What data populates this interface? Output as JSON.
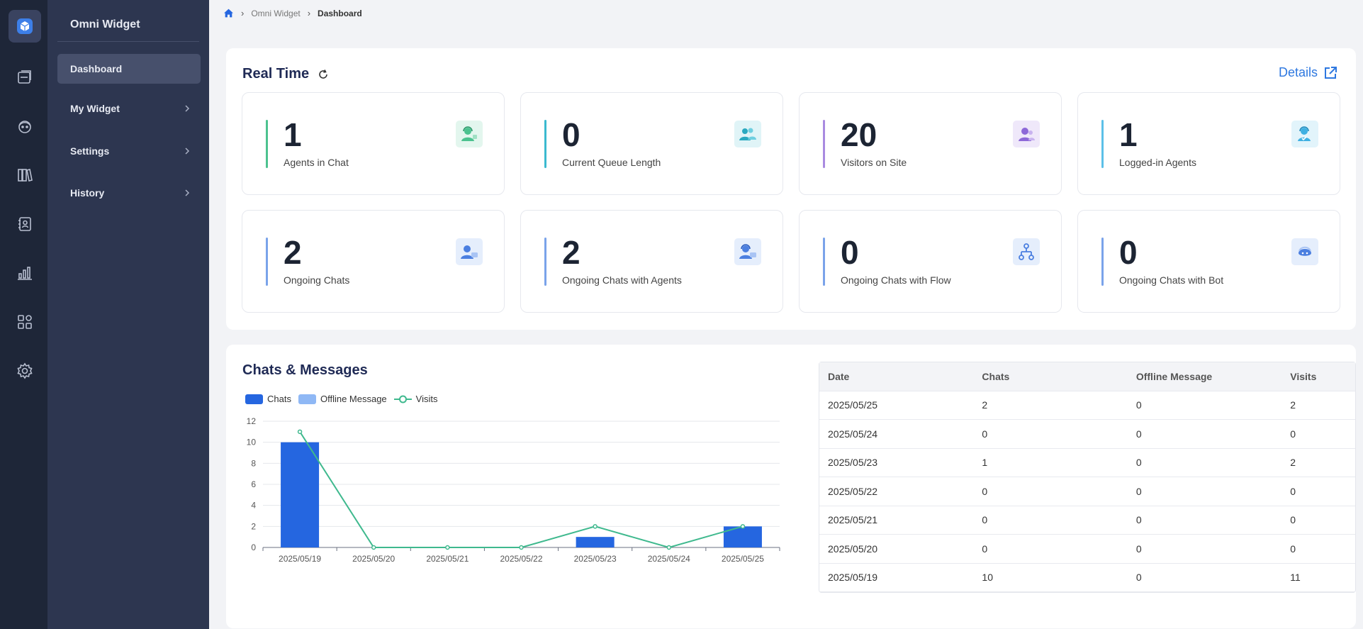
{
  "sidebar": {
    "title": "Omni Widget",
    "items": [
      {
        "label": "Dashboard"
      },
      {
        "label": "My Widget"
      },
      {
        "label": "Settings"
      },
      {
        "label": "History"
      }
    ]
  },
  "breadcrumb": {
    "items": [
      "Omni Widget",
      "Dashboard"
    ]
  },
  "realtime": {
    "title": "Real Time",
    "details_label": "Details",
    "cards": [
      {
        "value": "1",
        "label": "Agents in Chat",
        "accent": "#4cc28f",
        "icon": "agent-headset-icon"
      },
      {
        "value": "0",
        "label": "Current Queue Length",
        "accent": "#3bbad0",
        "icon": "queue-users-icon"
      },
      {
        "value": "20",
        "label": "Visitors on Site",
        "accent": "#a98ae0",
        "icon": "visitors-icon"
      },
      {
        "value": "1",
        "label": "Logged-in Agents",
        "accent": "#5cc0e8",
        "icon": "logged-agent-icon"
      },
      {
        "value": "2",
        "label": "Ongoing Chats",
        "accent": "#7aa3ea",
        "icon": "ongoing-chats-icon"
      },
      {
        "value": "2",
        "label": "Ongoing Chats with Agents",
        "accent": "#7aa3ea",
        "icon": "agent-chats-icon"
      },
      {
        "value": "0",
        "label": "Ongoing Chats with Flow",
        "accent": "#7aa3ea",
        "icon": "flow-icon"
      },
      {
        "value": "0",
        "label": "Ongoing Chats with Bot",
        "accent": "#7aa3ea",
        "icon": "bot-icon"
      }
    ]
  },
  "chats_messages": {
    "title": "Chats & Messages",
    "table": {
      "headers": [
        "Date",
        "Chats",
        "Offline Message",
        "Visits"
      ],
      "rows": [
        [
          "2025/05/25",
          "2",
          "0",
          "2"
        ],
        [
          "2025/05/24",
          "0",
          "0",
          "0"
        ],
        [
          "2025/05/23",
          "1",
          "0",
          "2"
        ],
        [
          "2025/05/22",
          "0",
          "0",
          "0"
        ],
        [
          "2025/05/21",
          "0",
          "0",
          "0"
        ],
        [
          "2025/05/20",
          "0",
          "0",
          "0"
        ],
        [
          "2025/05/19",
          "10",
          "0",
          "11"
        ]
      ]
    }
  },
  "chart_data": {
    "type": "bar",
    "categories": [
      "2025/05/19",
      "2025/05/20",
      "2025/05/21",
      "2025/05/22",
      "2025/05/23",
      "2025/05/24",
      "2025/05/25"
    ],
    "series": [
      {
        "name": "Chats",
        "type": "bar",
        "color": "#2566e0",
        "values": [
          10,
          0,
          0,
          0,
          1,
          0,
          2
        ]
      },
      {
        "name": "Offline Message",
        "type": "bar",
        "color": "#8fb8f5",
        "values": [
          0,
          0,
          0,
          0,
          0,
          0,
          0
        ]
      },
      {
        "name": "Visits",
        "type": "line",
        "color": "#3fb98e",
        "values": [
          11,
          0,
          0,
          0,
          2,
          0,
          2
        ]
      }
    ],
    "ylim": [
      0,
      12
    ],
    "yticks": [
      0,
      2,
      4,
      6,
      8,
      10,
      12
    ],
    "grid": true,
    "legend": "top-left"
  },
  "colors": {
    "rail_bg": "#1e2638",
    "sidebar_bg": "#2d3650",
    "accent_blue": "#2e78e0",
    "title_navy": "#1f2a55"
  }
}
